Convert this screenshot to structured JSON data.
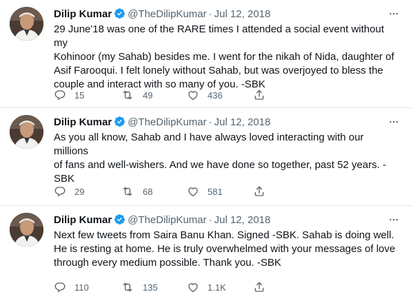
{
  "tweets": [
    {
      "author_name": "Dilip Kumar",
      "handle": "@TheDilipKumar",
      "separator": "·",
      "date": "Jul 12, 2018",
      "text": "29 June'18 was one of the RARE times I attended a social event without my\nKohinoor (my Sahab) besides me. I went for the nikah of Nida, daughter of\nAsif Farooqui. I felt lonely without Sahab, but was overjoyed to bless the\ncouple and interact with so many of you. -SBK",
      "replies": "15",
      "retweets": "49",
      "likes": "436"
    },
    {
      "author_name": "Dilip Kumar",
      "handle": "@TheDilipKumar",
      "separator": "·",
      "date": "Jul 12, 2018",
      "text": "As you all know, Sahab and I have always loved interacting with our millions\nof fans and well-wishers. And we have done so together, past 52 years. -\nSBK",
      "replies": "29",
      "retweets": "68",
      "likes": "581"
    },
    {
      "author_name": "Dilip Kumar",
      "handle": "@TheDilipKumar",
      "separator": "·",
      "date": "Jul 12, 2018",
      "text": "Next few tweets from Saira Banu Khan. Signed -SBK. Sahab is doing well.\nHe is resting at home. He is truly overwhelmed with your messages of love\nthrough every medium possible. Thank you. -SBK",
      "replies": "110",
      "retweets": "135",
      "likes": "1.1K"
    }
  ],
  "colors": {
    "text": "#0f1419",
    "secondary": "#536471",
    "verified": "#1d9bf0",
    "divider": "#e1e8ed"
  },
  "icons": {
    "verified": "verified-badge-icon",
    "more": "more-horizontal-icon",
    "reply": "reply-bubble-icon",
    "retweet": "retweet-icon",
    "like": "heart-icon",
    "share": "share-upload-icon"
  }
}
